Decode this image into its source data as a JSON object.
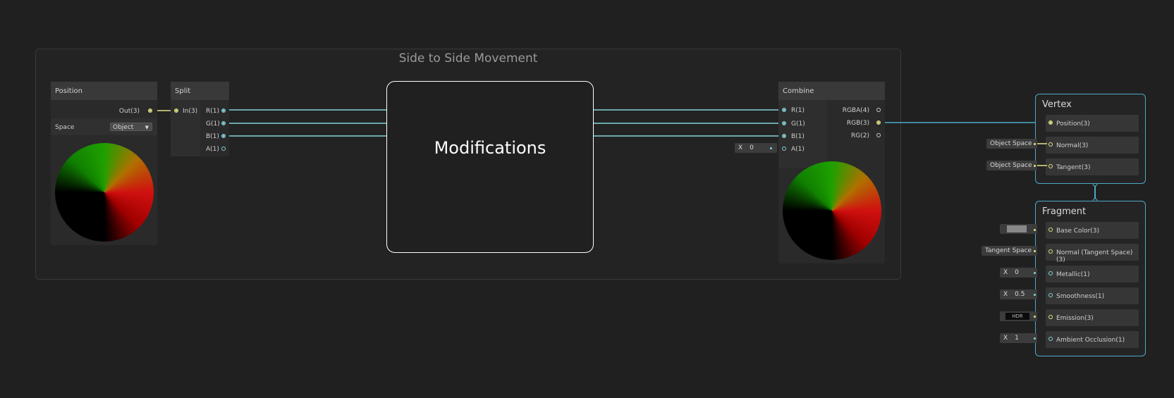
{
  "group": {
    "title": "Side to Side Movement"
  },
  "position_node": {
    "title": "Position",
    "out_label": "Out(3)",
    "space_label": "Space",
    "space_value": "Object"
  },
  "split_node": {
    "title": "Split",
    "in_label": "In(3)",
    "outputs": [
      "R(1)",
      "G(1)",
      "B(1)",
      "A(1)"
    ]
  },
  "subgraph": {
    "title": "Modifications"
  },
  "combine_node": {
    "title": "Combine",
    "inputs": [
      "R(1)",
      "G(1)",
      "B(1)",
      "A(1)"
    ],
    "outputs": [
      "RGBA(4)",
      "RGB(3)",
      "RG(2)"
    ],
    "a_field_axis": "X",
    "a_field_value": "0"
  },
  "vertex": {
    "title": "Vertex",
    "slots": [
      "Position(3)",
      "Normal(3)",
      "Tangent(3)"
    ],
    "normal_space": "Object Space",
    "tangent_space": "Object Space"
  },
  "fragment": {
    "title": "Fragment",
    "slots": [
      "Base Color(3)",
      "Normal (Tangent Space)(3)",
      "Metallic(1)",
      "Smoothness(1)",
      "Emission(3)",
      "Ambient Occlusion(1)"
    ],
    "normal_space": "Tangent Space",
    "metallic_axis": "X",
    "metallic_value": "0",
    "smoothness_axis": "X",
    "smoothness_value": "0.5",
    "emission_label": "HDR",
    "ao_axis": "X",
    "ao_value": "1",
    "base_color": "#888888"
  },
  "colors": {
    "wire_blue": "#83d3d8",
    "wire_yellow": "#e4e38a",
    "context_border": "#4da9c8",
    "background": "#202020"
  }
}
